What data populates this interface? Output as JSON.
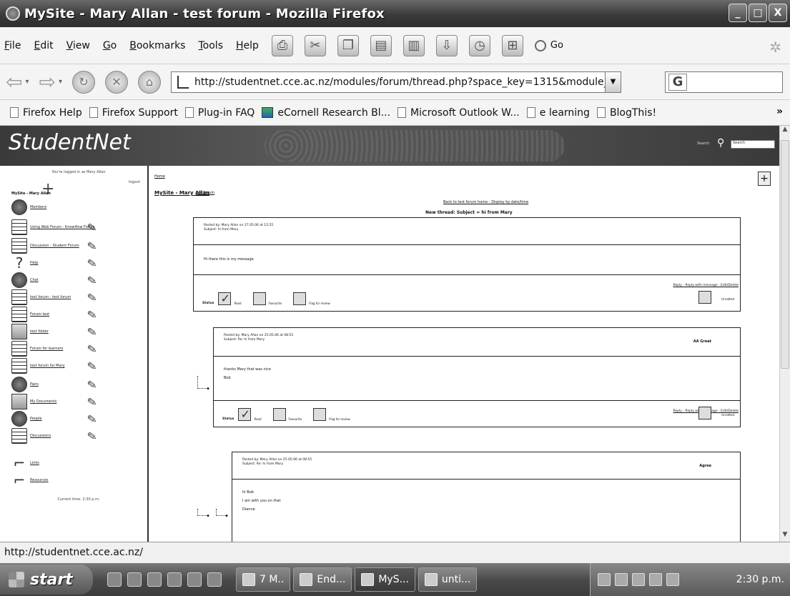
{
  "window": {
    "title": "MySite - Mary Allan - test forum - Mozilla Firefox",
    "controls": [
      "_",
      "□",
      "X"
    ]
  },
  "menubar": {
    "items": [
      {
        "label": "File",
        "accel": "F",
        "rest": "ile"
      },
      {
        "label": "Edit",
        "accel": "E",
        "rest": "dit"
      },
      {
        "label": "View",
        "accel": "V",
        "rest": "iew"
      },
      {
        "label": "Go",
        "accel": "G",
        "rest": "o"
      },
      {
        "label": "Bookmarks",
        "accel": "B",
        "rest": "ookmarks"
      },
      {
        "label": "Tools",
        "accel": "T",
        "rest": "ools"
      },
      {
        "label": "Help",
        "accel": "H",
        "rest": "elp"
      }
    ],
    "go_label": "Go"
  },
  "navbar": {
    "url": "http://studentnet.cce.ac.nz/modules/forum/thread.php?space_key=1315&module_k",
    "search_engine": "G"
  },
  "bookmarks": [
    {
      "label": "Firefox Help",
      "icon": "page-icon"
    },
    {
      "label": "Firefox Support",
      "icon": "page-icon"
    },
    {
      "label": "Plug-in FAQ",
      "icon": "page-icon"
    },
    {
      "label": "eCornell Research Bl...",
      "icon": "image-icon"
    },
    {
      "label": "Microsoft Outlook W...",
      "icon": "page-icon"
    },
    {
      "label": "e learning",
      "icon": "page-icon"
    },
    {
      "label": "BlogThis!",
      "icon": "page-icon"
    }
  ],
  "bookmarks_more": "»",
  "site": {
    "logo": "StudentNet",
    "search_label": "Search",
    "search_placeholder": "Search"
  },
  "sidebar": {
    "logged_in": "You're logged in as Mary Allan",
    "logout": "logout",
    "user": "MySite - Mary Allan",
    "items": [
      {
        "label": "Members",
        "icon": "people-icon"
      },
      {
        "label": "Using Web Forum - KnowHow Forum",
        "icon": "notepad-icon"
      },
      {
        "label": "Discussion - Student Forum",
        "icon": "notepad-icon"
      },
      {
        "label": "Help",
        "icon": "question-icon"
      },
      {
        "label": "Chat",
        "icon": "megaphone-icon"
      },
      {
        "label": "test forum - test forum",
        "icon": "notepad-icon"
      },
      {
        "label": "Forum test",
        "icon": "notepad-icon"
      },
      {
        "label": "test folder",
        "icon": "folder-icon"
      },
      {
        "label": "Forum for learners",
        "icon": "notepad-icon"
      },
      {
        "label": "test forum for Mary",
        "icon": "notepad-icon"
      },
      {
        "label": "Pairs",
        "icon": "pair-icon"
      },
      {
        "label": "My Documents",
        "icon": "folder-icon"
      },
      {
        "label": "People",
        "icon": "people-icon"
      },
      {
        "label": "Discussions",
        "icon": "stack-icon"
      }
    ],
    "extra": [
      {
        "label": "Links",
        "icon": "pipe-icon"
      },
      {
        "label": "Resources",
        "icon": "pipe-icon"
      }
    ],
    "footer": "Current time: 2:30 p.m."
  },
  "main": {
    "top_crumb": "Home",
    "site_crumb": "MySite - Mary Allan",
    "forum_crumb": "test forum",
    "links": "Back to test forum home - Display by date/time",
    "thread_title": "New thread: Subject = hi from Mary",
    "posts": [
      {
        "posted_by": "Posted by: Mary Allan on 27.05.06 at 12:55",
        "subject": "Subject: hi from Mary",
        "body": [
          "Hi there this is my message"
        ],
        "rating": "",
        "actions": "Reply - Reply with message - Edit/Delete",
        "status": "Status",
        "checks": [
          {
            "label": "Read",
            "checked": true
          },
          {
            "label": "Favourite",
            "checked": false
          },
          {
            "label": "Flag for review",
            "checked": false
          }
        ],
        "rate_label": "Unratted"
      },
      {
        "posted_by": "Posted by: Mary Allan on 25.05.06 at 08:55",
        "subject": "Subject: Re: hi from Mary",
        "body": [
          "thanks Mary that was nice",
          "Bob"
        ],
        "rating": "AA Great",
        "actions": "Reply - Reply with message - Edit/Delete",
        "status": "Status",
        "checks": [
          {
            "label": "Read",
            "checked": true
          },
          {
            "label": "Favourite",
            "checked": false
          },
          {
            "label": "Flag for review",
            "checked": false
          }
        ],
        "rate_label": "Unratted"
      },
      {
        "posted_by": "Posted by: Mary Allan on 25.05.06 at 08:55",
        "subject": "Subject: Re: hi from Mary",
        "body": [
          "hi Bob",
          "I am with you on that",
          "Dianne"
        ],
        "rating": "Agree",
        "actions": "",
        "status": "",
        "checks": [],
        "rate_label": ""
      }
    ]
  },
  "statusbar": {
    "text": "http://studentnet.cce.ac.nz/"
  },
  "taskbar": {
    "start": "start",
    "tasks": [
      {
        "label": "7 M..",
        "icon": "word-icon"
      },
      {
        "label": "End...",
        "icon": "paint-icon"
      },
      {
        "label": "MyS...",
        "icon": "firefox-icon",
        "active": true
      },
      {
        "label": "unti...",
        "icon": "paint-icon"
      }
    ],
    "clock": "2:30 p.m."
  }
}
